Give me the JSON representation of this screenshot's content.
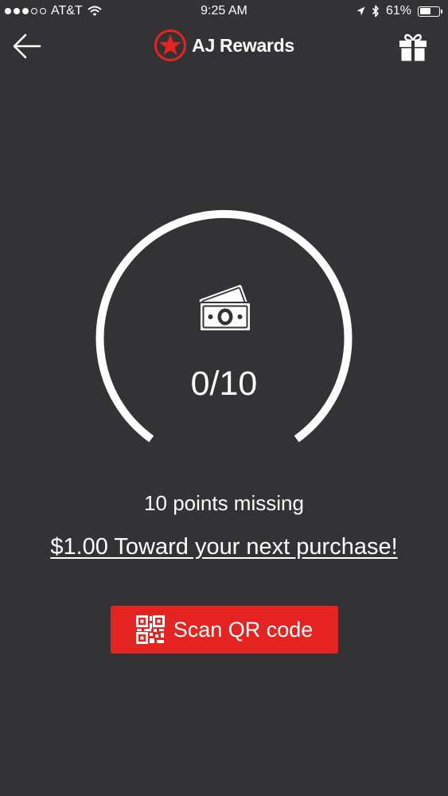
{
  "status_bar": {
    "carrier": "AT&T",
    "time": "9:25 AM",
    "battery": "61%",
    "battery_level": 0.61,
    "signal_filled": 3,
    "signal_total": 5
  },
  "header": {
    "title": "AJ Rewards",
    "back_icon": "back-arrow-icon",
    "logo_icon": "star-logo-icon",
    "gift_icon": "gift-icon"
  },
  "progress": {
    "value_text": "0/10",
    "current": 0,
    "total": 10,
    "icon": "cash-icon"
  },
  "reward": {
    "missing_text": "10 points missing",
    "offer_text": "$1.00 Toward your next purchase!"
  },
  "scan_button": {
    "label": "Scan QR code",
    "icon": "qr-code-icon"
  },
  "colors": {
    "background": "#333234",
    "accent": "#e52421",
    "text": "#ffffff"
  }
}
